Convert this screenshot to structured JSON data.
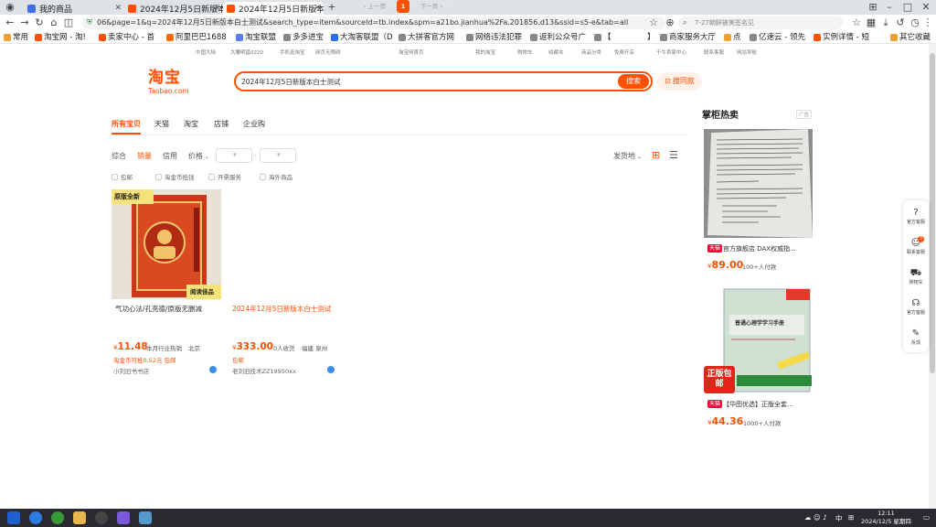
{
  "browser": {
    "tabs": [
      {
        "label": "我的商品"
      },
      {
        "label": "2024年12月5日新版本白士测试"
      },
      {
        "label": "2024年12月5日新版本白士测试"
      }
    ],
    "url": "06&page=1&q=2024年12月5日新版本白士测试&search_type=item&sourceId=tb.index&spm=a21bo.jianhua%2Fa.201856.d13&ssid=s5-e&tab=all",
    "search_placeholder": "7-27朝鲜被美签名见"
  },
  "bookmarks": [
    "常用",
    "淘宝网 - 淘!",
    "卖家中心 - 首",
    "阿里巴巴1688",
    "淘宝联盟",
    "多多进宝",
    "大淘客联盟（D",
    "大拼客官方网",
    "网络违法犯罪",
    "返利公众号广",
    "【",
    "】",
    "商家服务大厅",
    "点",
    "亿速云 - 领先",
    "实例详情 - 短",
    "其它收藏"
  ],
  "site_nav": [
    "中国大陆",
    "大腰明昌0220",
    "手机逛淘宝",
    "网页无障碍",
    "淘宝网首页",
    "我的淘宝",
    "购物车",
    "收藏夹",
    "商品分类",
    "免费开店",
    "千牛卖家中心",
    "联系客服",
    "网站导航"
  ],
  "header": {
    "logo_cn": "淘宝",
    "logo_en": "Taobao.com",
    "search_value": "2024年12月5日新版本白士测试",
    "search_button": "搜索",
    "same_style_button": "搜同款"
  },
  "category_tabs": [
    "所有宝贝",
    "天猫",
    "淘宝",
    "店铺",
    "企业购"
  ],
  "sort": {
    "items": [
      "综合",
      "销量",
      "信用"
    ],
    "price_label": "价格",
    "price_min_placeholder": "¥",
    "price_max_placeholder": "¥",
    "dash": "-",
    "ship_from": "发货地"
  },
  "filters": [
    "包邮",
    "淘金币抵钱",
    "开票服务",
    "海外商品"
  ],
  "products": [
    {
      "image_caption_top": "原版全新",
      "image_caption_bottom": "阅读佳品",
      "title": "气功心法/孔亮德/原版无删减",
      "price": "11.48",
      "sold": "本月行业热销",
      "location": "北京",
      "extra": "淘金币可抵0.52元 包邮",
      "shop": "小刘旧书书店"
    },
    {
      "title": "2024年12月5日新版本白士测试",
      "price": "333.00",
      "sold": "0人收货",
      "location": "福建 泉州",
      "extra": "包邮",
      "shop": "老刘旧技术ZZ19950xx"
    }
  ],
  "pager": {
    "prev": "上一页",
    "current": "1",
    "next": "下一页"
  },
  "hot": {
    "title": "掌柜热卖",
    "ad": "广告",
    "items": [
      {
        "tag": "天猫",
        "title": "官方旗舰店 DAX权威指...",
        "price": "89.00",
        "sold": "100+人付款"
      },
      {
        "tag": "天猫",
        "title": "【华图优选】正版全套...",
        "price": "44.36",
        "sold": "1000+人付款",
        "badge": "正版包邮",
        "book_title": "普通心理学学习手册"
      }
    ]
  },
  "side_tools": [
    {
      "icon": "?",
      "label": "官方客服"
    },
    {
      "icon": "☺",
      "label": "联系客服",
      "badge": "3"
    },
    {
      "icon": "⛟",
      "label": "购物车"
    },
    {
      "icon": "☊",
      "label": "官方客服"
    },
    {
      "icon": "✎",
      "label": "反馈"
    }
  ],
  "taskbar": {
    "time": "12:11",
    "date": "2024/12/5 星期四",
    "ime": "中"
  },
  "colors": {
    "accent": "#ff5000",
    "tmall": "#ff0036"
  }
}
